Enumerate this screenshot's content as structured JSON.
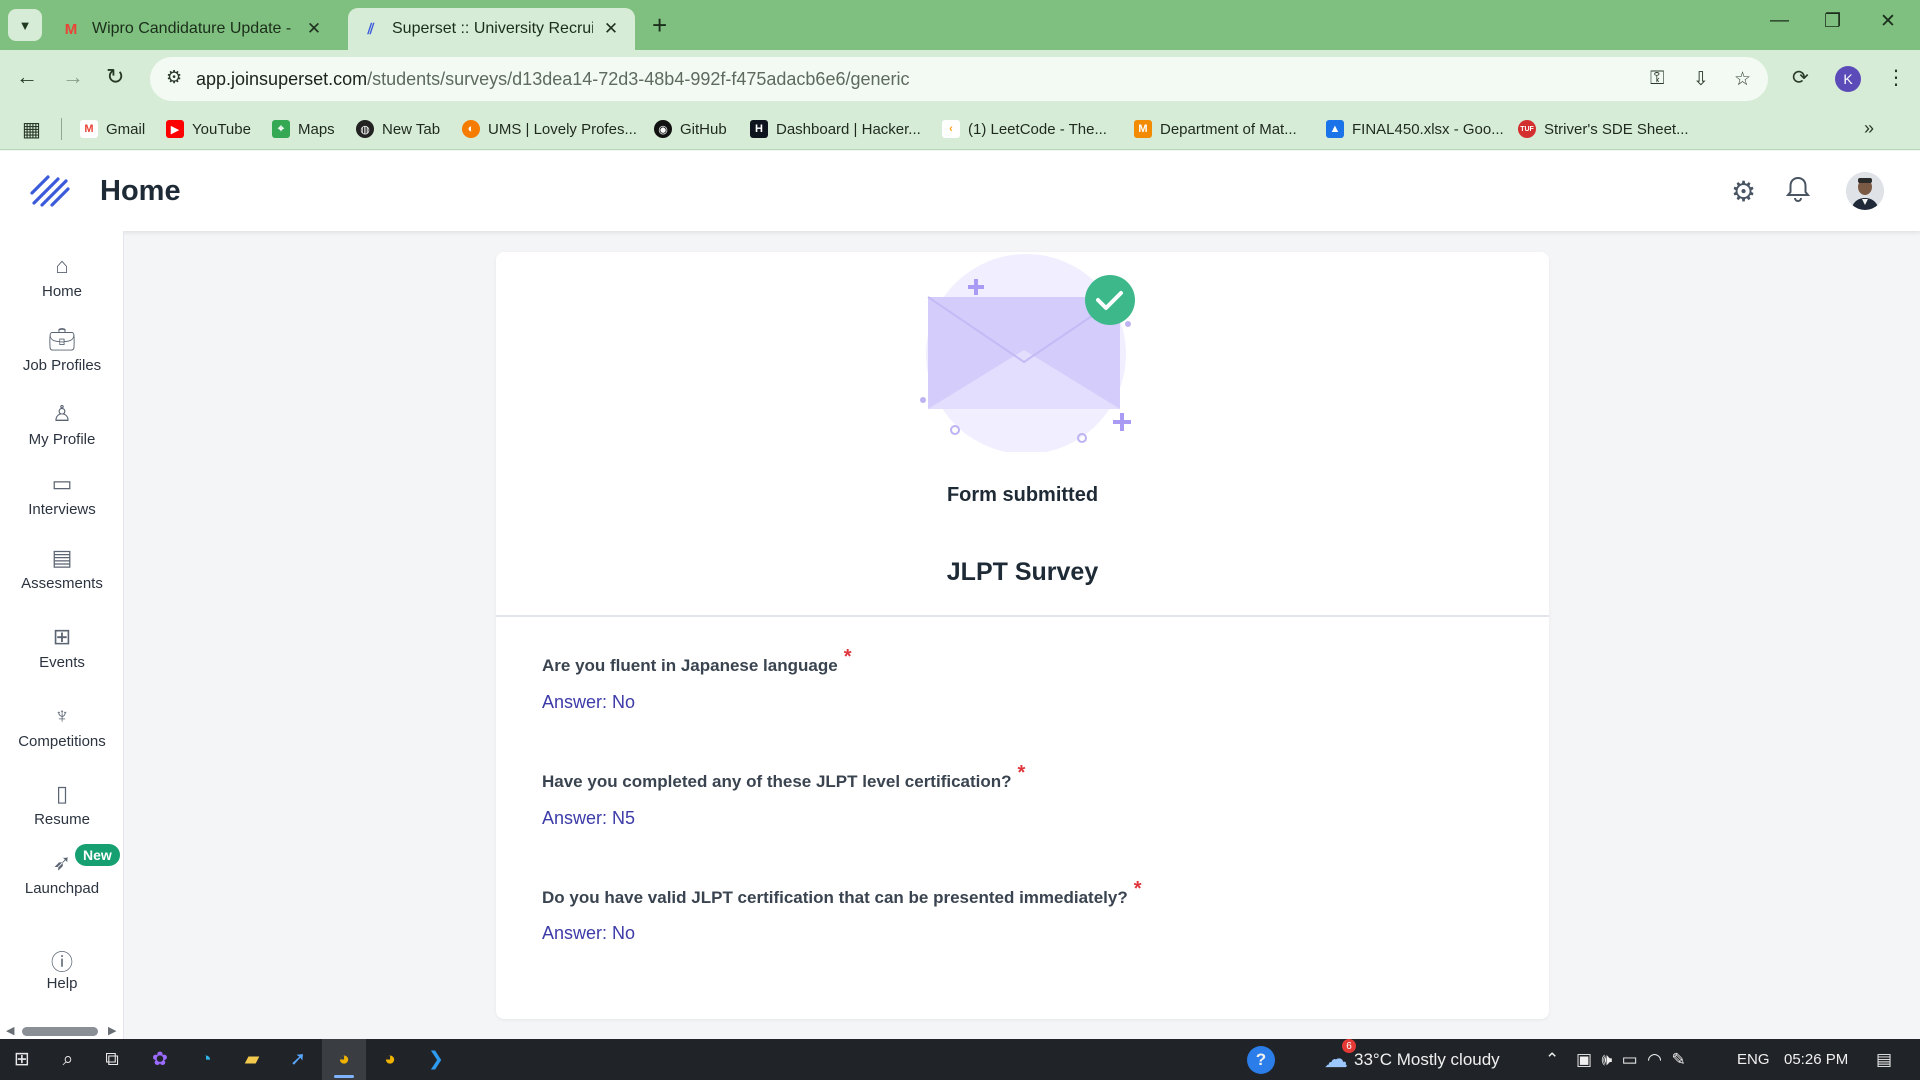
{
  "browser": {
    "tabs": [
      {
        "title": "Wipro Candidature Update - ka",
        "favicon": "gmail-icon",
        "active": false
      },
      {
        "title": "Superset :: University Recruiting",
        "favicon": "superset-icon",
        "active": true
      }
    ],
    "new_tab_symbol": "+",
    "url_domain": "app.joinsuperset.com",
    "url_path": "/students/surveys/d13dea14-72d3-48b4-992f-f475adacb6e6/generic",
    "profile_initial": "K",
    "bookmarks": [
      {
        "label": "Gmail",
        "icon": "gmail-icon",
        "color": "#ea4335"
      },
      {
        "label": "YouTube",
        "icon": "youtube-icon",
        "color": "#ff0000"
      },
      {
        "label": "Maps",
        "icon": "maps-icon",
        "color": "#34a853"
      },
      {
        "label": "New Tab",
        "icon": "globe-icon",
        "color": "#222222"
      },
      {
        "label": "UMS | Lovely Profes...",
        "icon": "lpu-icon",
        "color": "#f57c00"
      },
      {
        "label": "GitHub",
        "icon": "github-icon",
        "color": "#111111"
      },
      {
        "label": "Dashboard | Hacker...",
        "icon": "hackerrank-icon",
        "color": "#0e141e"
      },
      {
        "label": "(1) LeetCode - The...",
        "icon": "leetcode-icon",
        "color": "#ffa116"
      },
      {
        "label": "Department of Mat...",
        "icon": "department-icon",
        "color": "#f28b00"
      },
      {
        "label": "FINAL450.xlsx - Goo...",
        "icon": "drive-icon",
        "color": "#1a73e8"
      },
      {
        "label": "Striver's SDE Sheet...",
        "icon": "tuf-icon",
        "color": "#d32f2f"
      }
    ]
  },
  "app": {
    "title": "Home",
    "brand_color": "#3b5bdb"
  },
  "sidebar": {
    "items": [
      {
        "label": "Home",
        "icon": "home-icon"
      },
      {
        "label": "Job Profiles",
        "icon": "briefcase-icon"
      },
      {
        "label": "My Profile",
        "icon": "user-icon"
      },
      {
        "label": "Interviews",
        "icon": "laptop-icon"
      },
      {
        "label": "Assesments",
        "icon": "clipboard-icon"
      },
      {
        "label": "Events",
        "icon": "grid-icon"
      },
      {
        "label": "Competitions",
        "icon": "trophy-icon"
      },
      {
        "label": "Resume",
        "icon": "document-icon"
      },
      {
        "label": "Launchpad",
        "icon": "rocket-icon",
        "badge": "New"
      },
      {
        "label": "Help",
        "icon": "info-icon"
      }
    ]
  },
  "survey": {
    "status": "Form submitted",
    "title": "JLPT Survey",
    "required_marker": "*",
    "questions": [
      {
        "question": "Are you fluent in Japanese language",
        "answer": "Answer: No"
      },
      {
        "question": "Have you completed any of these JLPT level certification?",
        "answer": "Answer: N5"
      },
      {
        "question": "Do you have valid JLPT certification that can be presented immediately?",
        "answer": "Answer: No"
      }
    ]
  },
  "taskbar": {
    "weather_badge": "6",
    "weather": "33°C  Mostly cloudy",
    "language": "ENG",
    "time": "05:26 PM"
  }
}
